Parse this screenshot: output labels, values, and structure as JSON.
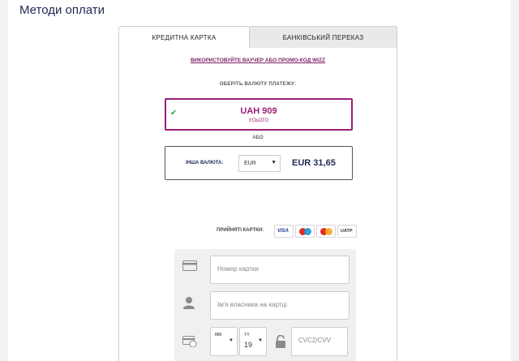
{
  "page": {
    "title": "Методи оплати"
  },
  "tabs": [
    {
      "label": "КРЕДИТНА КАРТКА",
      "active": true
    },
    {
      "label": "БАНКІВСЬКИЙ ПЕРЕКАЗ",
      "active": false
    }
  ],
  "voucher_link": "ВИКОРИСТОВУЙТЕ ВАУЧЕР АБО ПРОМО-КОД WIZZ",
  "choose_currency": "ОБЕРІТЬ ВАЛЮТУ ПЛАТЕЖУ:",
  "primary_currency": {
    "amount": "UAH 909",
    "caption": "УСЬОГО",
    "selected": true
  },
  "or_label": "АБО",
  "other_currency": {
    "label": "ІНША ВАЛЮТА:",
    "selected_code": "EUR",
    "amount": "EUR 31,65"
  },
  "accepted_cards": {
    "label": "ПРИЙНЯТІ КАРТКИ:",
    "logos": [
      "VISA",
      "maestro",
      "mastercard",
      "UATP"
    ]
  },
  "card_form": {
    "card_number_placeholder": "Номер картки",
    "holder_placeholder": "Ім'я власника на картці",
    "month_label": "MM",
    "month_value": "",
    "year_label": "YY",
    "year_value": "19",
    "cvc_placeholder": "CVC2/CVV"
  },
  "colors": {
    "accent": "#9b1f79",
    "navy": "#1f2a55",
    "check": "#2aa845"
  }
}
